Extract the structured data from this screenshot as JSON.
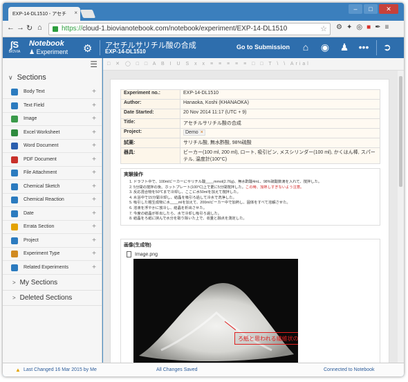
{
  "browser": {
    "tab_title": "EXP-14-DL1510 - アセチ",
    "tab_close": "×",
    "url_scheme": "https://",
    "url_rest": "cloud-1.biovianotebook.com/notebook/experiment/EXP-14-DL1510"
  },
  "app": {
    "logo_text": "BIOVIA",
    "notebook_label": "Notebook",
    "experiment_label": "Experiment",
    "experiment_title": "アセチルサリチル酸の合成",
    "experiment_id": "EXP-14-DL1510",
    "go_to_submission": "Go to Submission"
  },
  "sidebar": {
    "sections_label": "Sections",
    "items": [
      {
        "label": "Body Text",
        "icon": "body-text-icon",
        "color": "#2b7bbf"
      },
      {
        "label": "Text Field",
        "icon": "text-field-icon",
        "color": "#2b7bbf"
      },
      {
        "label": "Image",
        "icon": "image-icon",
        "color": "#3a9a4a"
      },
      {
        "label": "Excel Worksheet",
        "icon": "excel-icon",
        "color": "#2e8b3e"
      },
      {
        "label": "Word Document",
        "icon": "word-icon",
        "color": "#2b5fae"
      },
      {
        "label": "PDF Document",
        "icon": "pdf-icon",
        "color": "#c8302a"
      },
      {
        "label": "File Attachment",
        "icon": "attachment-icon",
        "color": "#2b7bbf"
      },
      {
        "label": "Chemical Sketch",
        "icon": "chemical-sketch-icon",
        "color": "#2b7bbf"
      },
      {
        "label": "Chemical Reaction",
        "icon": "chemical-reaction-icon",
        "color": "#2b7bbf"
      },
      {
        "label": "Date",
        "icon": "date-icon",
        "color": "#2b7bbf"
      },
      {
        "label": "Errata Section",
        "icon": "warning-icon",
        "color": "#e4a300"
      },
      {
        "label": "Project",
        "icon": "project-icon",
        "color": "#2b7bbf"
      },
      {
        "label": "Experiment Type",
        "icon": "experiment-type-icon",
        "color": "#d08a20"
      },
      {
        "label": "Related Experiments",
        "icon": "related-experiments-icon",
        "color": "#2b7bbf"
      }
    ],
    "my_sections_label": "My Sections",
    "deleted_sections_label": "Deleted Sections"
  },
  "editor": {
    "toolbar_placeholder": "Arial",
    "metadata": [
      {
        "key": "Experiment no.:",
        "value": "EXP-14-DL1510"
      },
      {
        "key": "Author:",
        "value": "Hanaoka, Koshi (KHANAOKA)"
      },
      {
        "key": "Date Started:",
        "value": "20 Nov 2014 11:17 (UTC + 9)"
      },
      {
        "key": "Title:",
        "value": "アセチルサリチル酸の合成"
      },
      {
        "key": "Project:",
        "value": "Demo"
      },
      {
        "key": "試薬:",
        "value": "サリチル酸, 無水酢酸, 98%硫酸"
      },
      {
        "key": "器具:",
        "value": "ビーカー(100 ml, 200 ml), ロート, 吸引ビン, メスシリンダー(100 ml), かくはん棒, スパーテル, 温度計(100°C)"
      }
    ],
    "procedure_title": "実験操作",
    "steps": [
      {
        "text": "ドラフト中で、100mlビーカーにサリチル酸____mmol(2.76g)、無水酢酸4mL、98%硫酸数滴を入れて、撹拌した。",
        "note": ""
      },
      {
        "text": "5分間の撹拌の後、ホットプレート(100°C)上で更に5分間撹拌した。",
        "note": "この時、加熱しすぎないよう注意。"
      },
      {
        "text": "反応混合物を50℃まで冷却し、ここに水50mlを加えて撹拌した。",
        "note": ""
      },
      {
        "text": "水浴中で15分間冷却し、結晶を吸引ろ過して冷水で洗浄した。",
        "note": ""
      },
      {
        "text": "吸引した粗生成物に水____mlを加えて、200mlビーカー中で加熱し、固体をすべて溶解させた。",
        "note": ""
      },
      {
        "text": "溶液を浮やかに放冷し、結晶を析出させた。",
        "note": ""
      },
      {
        "text": "今度の結晶が析出したら、水で冷却し吸引ろ過した。",
        "note": ""
      },
      {
        "text": "結晶をろ紙に挟んで水分を取り除いた上で、収量と融点を測定した。",
        "note": ""
      }
    ],
    "image_section_title": "画像(生成物)",
    "image_file_name": "Image.png",
    "image_annotation": "ろ紙と思われる繊維状のものが混入"
  },
  "status": {
    "last_changed": "Last Changed 16 Mar 2015 by Me",
    "saved": "All Changes Saved",
    "connection": "Connected to Notebook"
  }
}
